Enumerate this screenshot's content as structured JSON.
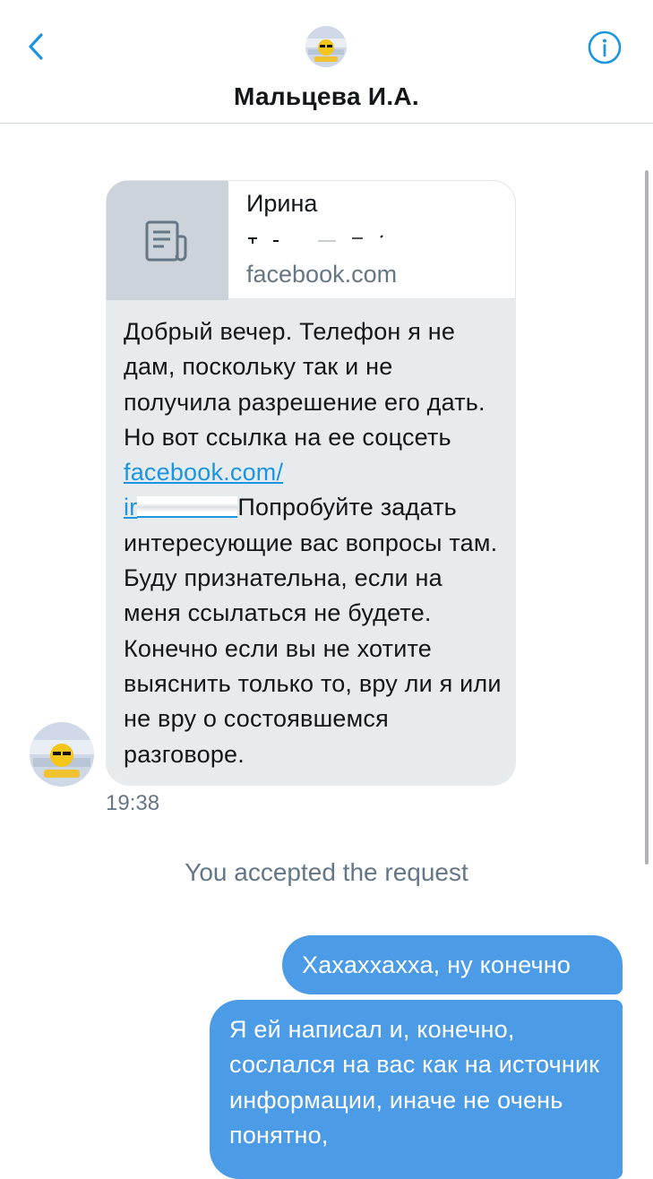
{
  "header": {
    "back_icon": "chevron-left-icon",
    "contact_name": "Мальцева И.А.",
    "info_icon": "info-circle-icon",
    "accent_color": "#1b95e0"
  },
  "message_in": {
    "link_preview": {
      "thumbnail_icon": "article-icon",
      "title_line": "Ирина",
      "domain": "facebook.com"
    },
    "text_before_link": "Добрый вечер. Телефон я не дам, поскольку так и не получила разрешение его дать. Но вот ссылка на ее соцсеть ",
    "link_text": "facebook.com/",
    "link_text_tail": "ir",
    "text_after_link": "Попробуйте задать интересующие вас вопросы там. Буду признательна, если на меня ссылаться не будете. Конечно если вы не хотите выяснить только то, вру ли я или не вру о состоявшемся разговоре.",
    "time": "19:38"
  },
  "system_note": "You accepted the request",
  "messages_out": [
    {
      "text": "Хахаххахха, ну конечно"
    },
    {
      "text": "Я ей написал и, конечно, сослался на вас как на источник информации, иначе не очень понятно,"
    }
  ],
  "colors": {
    "outgoing_bubble": "#4b9be6",
    "incoming_bubble": "#e8ebee",
    "link": "#1b95e0",
    "secondary_text": "#657786"
  }
}
